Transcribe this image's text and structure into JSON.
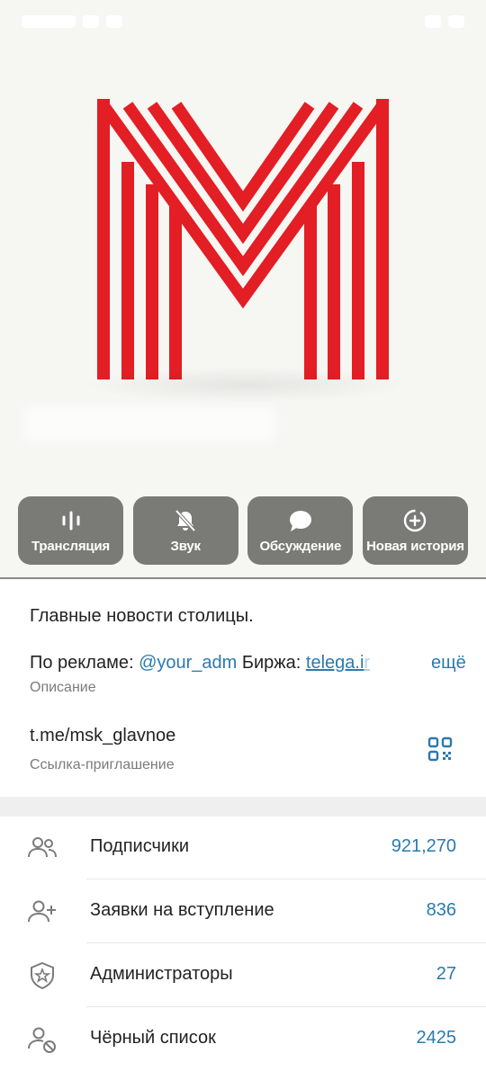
{
  "channel": {
    "actions": [
      {
        "label": "Трансляция",
        "icon": "broadcast-icon"
      },
      {
        "label": "Звук",
        "icon": "bell-off-icon"
      },
      {
        "label": "Обсуждение",
        "icon": "chat-bubble-icon"
      },
      {
        "label": "Новая история",
        "icon": "new-story-icon"
      }
    ],
    "description": "Главные новости столицы.",
    "ad_prefix": "По рекламе: ",
    "ad_handle": "@your_adm",
    "exchange_prefix": " Биржа: ",
    "exchange_link": "telega.i",
    "exchange_link_fade": "r",
    "more": "ещё",
    "description_label": "Описание",
    "invite_link": "t.me/msk_glavnoe",
    "invite_label": "Ссылка-приглашение"
  },
  "stats": [
    {
      "label": "Подписчики",
      "value": "921,270",
      "icon": "subscribers-icon"
    },
    {
      "label": "Заявки на вступление",
      "value": "836",
      "icon": "join-requests-icon"
    },
    {
      "label": "Администраторы",
      "value": "27",
      "icon": "admin-shield-icon"
    },
    {
      "label": "Чёрный список",
      "value": "2425",
      "icon": "blocked-user-icon"
    }
  ],
  "colors": {
    "logo_red": "#e31e24",
    "accent": "#2a7ab0",
    "button_bg": "#7a7a76"
  }
}
